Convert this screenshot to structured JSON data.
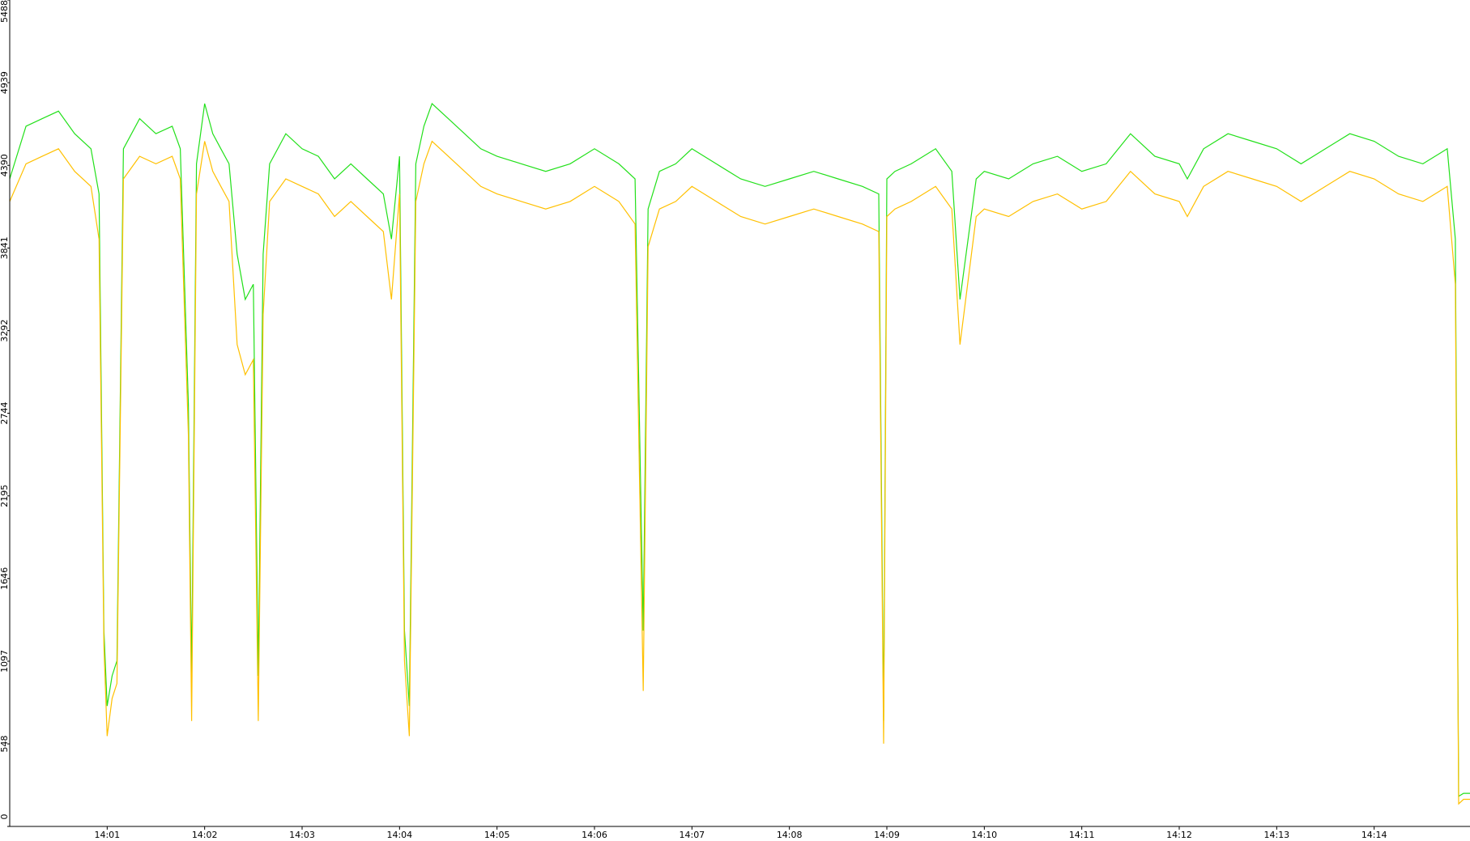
{
  "chart_data": {
    "type": "line",
    "title": "",
    "xlabel": "",
    "ylabel": "",
    "grid": false,
    "legend": "none",
    "ylim": [
      0,
      5488
    ],
    "y_ticks": [
      "0",
      "548",
      "1097",
      "1646",
      "2195",
      "2744",
      "3292",
      "3841",
      "4390",
      "4939",
      "5488"
    ],
    "y_tick_values": [
      0,
      548,
      1097,
      1646,
      2195,
      2744,
      3292,
      3841,
      4390,
      4939,
      5488
    ],
    "x_unit": "minutes",
    "xlim": [
      "14:00:00",
      "14:14:59"
    ],
    "x_ticks": [
      "14:01",
      "14:02",
      "14:03",
      "14:04",
      "14:05",
      "14:06",
      "14:07",
      "14:08",
      "14:09",
      "14:10",
      "14:11",
      "14:12",
      "14:13",
      "14:14"
    ],
    "x_tick_values": [
      "14:01:00",
      "14:02:00",
      "14:03:00",
      "14:04:00",
      "14:05:00",
      "14:06:00",
      "14:07:00",
      "14:08:00",
      "14:09:00",
      "14:10:00",
      "14:11:00",
      "14:12:00",
      "14:13:00",
      "14:14:00"
    ],
    "colors": {
      "series_a": "#22e01a",
      "series_b": "#ffc000",
      "axis": "#000000",
      "background": "#ffffff"
    },
    "series": [
      {
        "color": "#22e01a",
        "x": [
          "14:00:00",
          "14:00:10",
          "14:00:20",
          "14:00:30",
          "14:00:40",
          "14:00:50",
          "14:00:55",
          "14:00:58",
          "14:01:00",
          "14:01:03",
          "14:01:06",
          "14:01:10",
          "14:01:20",
          "14:01:30",
          "14:01:40",
          "14:01:45",
          "14:01:50",
          "14:01:52",
          "14:01:55",
          "14:02:00",
          "14:02:05",
          "14:02:10",
          "14:02:15",
          "14:02:20",
          "14:02:25",
          "14:02:30",
          "14:02:33",
          "14:02:36",
          "14:02:40",
          "14:02:50",
          "14:03:00",
          "14:03:10",
          "14:03:20",
          "14:03:30",
          "14:03:40",
          "14:03:50",
          "14:03:55",
          "14:04:00",
          "14:04:03",
          "14:04:06",
          "14:04:10",
          "14:04:15",
          "14:04:20",
          "14:04:30",
          "14:04:40",
          "14:04:50",
          "14:05:00",
          "14:05:15",
          "14:05:30",
          "14:05:45",
          "14:06:00",
          "14:06:15",
          "14:06:25",
          "14:06:30",
          "14:06:33",
          "14:06:40",
          "14:06:50",
          "14:07:00",
          "14:07:15",
          "14:07:30",
          "14:07:45",
          "14:08:00",
          "14:08:15",
          "14:08:30",
          "14:08:45",
          "14:08:55",
          "14:08:58",
          "14:09:00",
          "14:09:05",
          "14:09:15",
          "14:09:30",
          "14:09:40",
          "14:09:45",
          "14:09:55",
          "14:10:00",
          "14:10:15",
          "14:10:30",
          "14:10:45",
          "14:11:00",
          "14:11:15",
          "14:11:30",
          "14:11:45",
          "14:12:00",
          "14:12:05",
          "14:12:15",
          "14:12:30",
          "14:12:45",
          "14:13:00",
          "14:13:15",
          "14:13:30",
          "14:13:45",
          "14:14:00",
          "14:14:15",
          "14:14:30",
          "14:14:45",
          "14:14:50",
          "14:14:52",
          "14:14:55",
          "14:14:59"
        ],
        "values": [
          4300,
          4650,
          4700,
          4750,
          4600,
          4500,
          4200,
          1300,
          800,
          1000,
          1100,
          4500,
          4700,
          4600,
          4650,
          4500,
          2800,
          1000,
          4400,
          4800,
          4600,
          4500,
          4400,
          3800,
          3500,
          3600,
          1000,
          3800,
          4400,
          4600,
          4500,
          4450,
          4300,
          4400,
          4300,
          4200,
          3900,
          4450,
          1300,
          800,
          4400,
          4650,
          4800,
          4700,
          4600,
          4500,
          4450,
          4400,
          4350,
          4400,
          4500,
          4400,
          4300,
          1300,
          4100,
          4350,
          4400,
          4500,
          4400,
          4300,
          4250,
          4300,
          4350,
          4300,
          4250,
          4200,
          700,
          4300,
          4350,
          4400,
          4500,
          4350,
          3500,
          4300,
          4350,
          4300,
          4400,
          4450,
          4350,
          4400,
          4600,
          4450,
          4400,
          4300,
          4500,
          4600,
          4550,
          4500,
          4400,
          4500,
          4600,
          4550,
          4450,
          4400,
          4500,
          3900,
          200,
          220,
          220
        ]
      },
      {
        "color": "#ffc000",
        "x": [
          "14:00:00",
          "14:00:10",
          "14:00:20",
          "14:00:30",
          "14:00:40",
          "14:00:50",
          "14:00:55",
          "14:00:58",
          "14:01:00",
          "14:01:03",
          "14:01:06",
          "14:01:10",
          "14:01:20",
          "14:01:30",
          "14:01:40",
          "14:01:45",
          "14:01:50",
          "14:01:52",
          "14:01:55",
          "14:02:00",
          "14:02:05",
          "14:02:10",
          "14:02:15",
          "14:02:20",
          "14:02:25",
          "14:02:30",
          "14:02:33",
          "14:02:36",
          "14:02:40",
          "14:02:50",
          "14:03:00",
          "14:03:10",
          "14:03:20",
          "14:03:30",
          "14:03:40",
          "14:03:50",
          "14:03:55",
          "14:04:00",
          "14:04:03",
          "14:04:06",
          "14:04:10",
          "14:04:15",
          "14:04:20",
          "14:04:30",
          "14:04:40",
          "14:04:50",
          "14:05:00",
          "14:05:15",
          "14:05:30",
          "14:05:45",
          "14:06:00",
          "14:06:15",
          "14:06:25",
          "14:06:30",
          "14:06:33",
          "14:06:40",
          "14:06:50",
          "14:07:00",
          "14:07:15",
          "14:07:30",
          "14:07:45",
          "14:08:00",
          "14:08:15",
          "14:08:30",
          "14:08:45",
          "14:08:55",
          "14:08:58",
          "14:09:00",
          "14:09:05",
          "14:09:15",
          "14:09:30",
          "14:09:40",
          "14:09:45",
          "14:09:55",
          "14:10:00",
          "14:10:15",
          "14:10:30",
          "14:10:45",
          "14:11:00",
          "14:11:15",
          "14:11:30",
          "14:11:45",
          "14:12:00",
          "14:12:05",
          "14:12:15",
          "14:12:30",
          "14:12:45",
          "14:13:00",
          "14:13:15",
          "14:13:30",
          "14:13:45",
          "14:14:00",
          "14:14:15",
          "14:14:30",
          "14:14:45",
          "14:14:50",
          "14:14:52",
          "14:14:55",
          "14:14:59"
        ],
        "values": [
          4150,
          4400,
          4450,
          4500,
          4350,
          4250,
          3900,
          1200,
          600,
          850,
          950,
          4300,
          4450,
          4400,
          4450,
          4300,
          2600,
          700,
          4200,
          4550,
          4350,
          4250,
          4150,
          3200,
          3000,
          3100,
          700,
          3400,
          4150,
          4300,
          4250,
          4200,
          4050,
          4150,
          4050,
          3950,
          3500,
          4200,
          1100,
          600,
          4150,
          4400,
          4550,
          4450,
          4350,
          4250,
          4200,
          4150,
          4100,
          4150,
          4250,
          4150,
          4000,
          900,
          3850,
          4100,
          4150,
          4250,
          4150,
          4050,
          4000,
          4050,
          4100,
          4050,
          4000,
          3950,
          550,
          4050,
          4100,
          4150,
          4250,
          4100,
          3200,
          4050,
          4100,
          4050,
          4150,
          4200,
          4100,
          4150,
          4350,
          4200,
          4150,
          4050,
          4250,
          4350,
          4300,
          4250,
          4150,
          4250,
          4350,
          4300,
          4200,
          4150,
          4250,
          3600,
          150,
          180,
          180
        ]
      }
    ]
  }
}
